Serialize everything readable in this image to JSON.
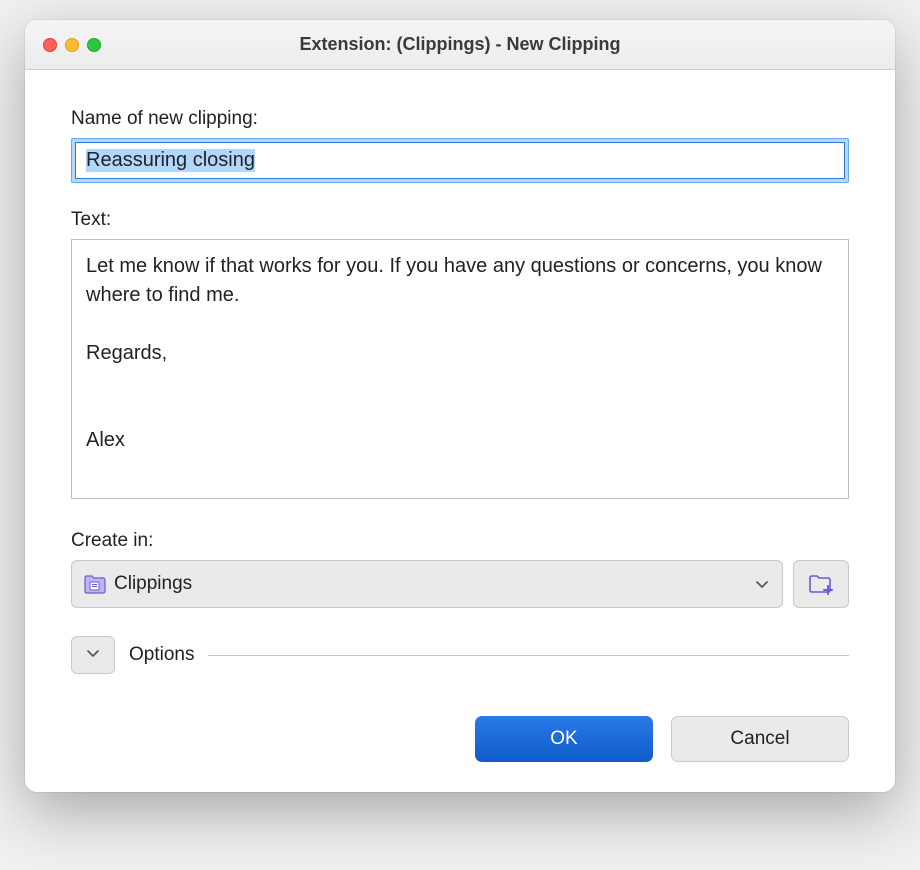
{
  "window": {
    "title": "Extension: (Clippings) - New Clipping"
  },
  "labels": {
    "name": "Name of new clipping:",
    "text": "Text:",
    "create_in": "Create in:",
    "options": "Options"
  },
  "values": {
    "clipping_name": "Reassuring closing",
    "clipping_text": "Let me know if that works for you. If you have any questions or concerns, you know where to find me.\n\nRegards,\n\n\nAlex",
    "folder_selected": "Clippings"
  },
  "buttons": {
    "ok": "OK",
    "cancel": "Cancel"
  },
  "colors": {
    "accent_purple": "#6a5cd1",
    "primary_blue": "#1162d9"
  }
}
